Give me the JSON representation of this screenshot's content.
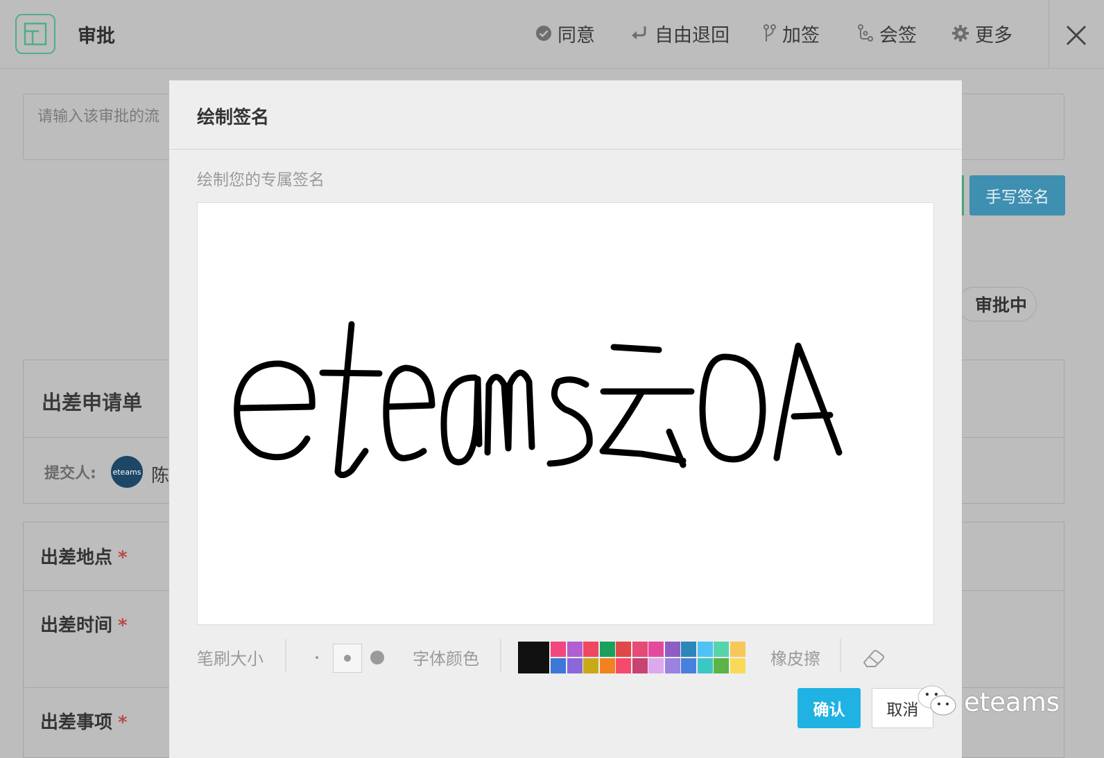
{
  "header": {
    "title": "审批",
    "actions": {
      "approve": "同意",
      "free_return": "自由退回",
      "add_sign": "加签",
      "countersign": "会签",
      "more": "更多"
    }
  },
  "page": {
    "flow_input_placeholder": "请输入该审批的流",
    "handwrite_button": "手写签名",
    "status": "审批中",
    "form_title": "出差申请单",
    "submitter_label": "提交人:",
    "submitter_avatar_text": "eteams",
    "submitter_name": "陈",
    "fields": {
      "location": "出差地点",
      "time": "出差时间",
      "matter": "出差事项"
    },
    "required_mark": "*"
  },
  "modal": {
    "title": "绘制签名",
    "hint": "绘制您的专属签名",
    "brush_size_label": "笔刷大小",
    "font_color_label": "字体颜色",
    "eraser_label": "橡皮擦",
    "confirm": "确认",
    "cancel": "取消",
    "colors": {
      "selected": "#111111",
      "row1": [
        "#f2477e",
        "#b15fd1",
        "#f04860",
        "#19a15b",
        "#e14849",
        "#e64a75",
        "#e34a9e",
        "#8c5ec4",
        "#2b87b8",
        "#4fc3f5",
        "#58d4ab",
        "#f7c75a"
      ],
      "row2": [
        "#3d77d8",
        "#8c67d9",
        "#c8aa16",
        "#f2811f",
        "#f54b6a",
        "#c84373",
        "#dca9ec",
        "#9b82e1",
        "#4880e0",
        "#3bc8c3",
        "#5ab447",
        "#f9d958"
      ]
    }
  },
  "watermark": {
    "text": "eteams"
  }
}
